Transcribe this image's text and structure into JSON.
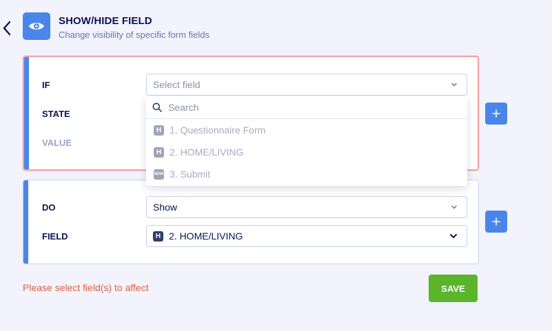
{
  "header": {
    "title": "SHOW/HIDE FIELD",
    "subtitle": "Change visibility of specific form fields",
    "icon": "eye-icon",
    "accent": "#4a86e8"
  },
  "condition": {
    "if_label": "IF",
    "state_label": "STATE",
    "value_label": "VALUE",
    "field_select_placeholder": "Select field",
    "dropdown": {
      "search_placeholder": "Search",
      "items": [
        {
          "badge": "H",
          "label": "1. Questionnaire Form"
        },
        {
          "badge": "H",
          "label": "2. HOME/LIVING"
        },
        {
          "badge": "SEND",
          "label": "3. Submit"
        }
      ]
    }
  },
  "action": {
    "do_label": "DO",
    "do_value": "Show",
    "field_label": "FIELD",
    "field_badge": "H",
    "field_value": "2. HOME/LIVING"
  },
  "footer": {
    "error": "Please select field(s) to affect",
    "save_label": "SAVE",
    "error_color": "#d9603d",
    "save_color": "#5ab52a"
  }
}
